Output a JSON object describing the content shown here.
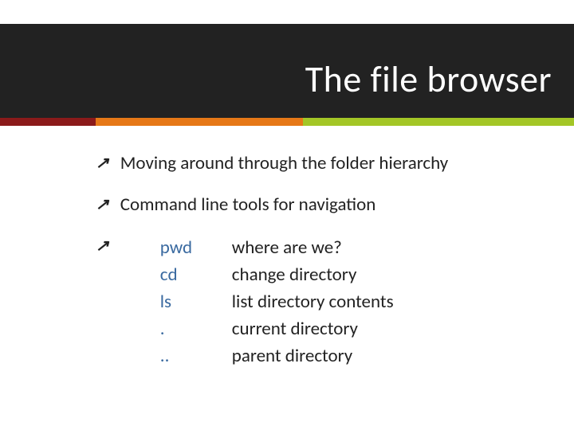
{
  "slide": {
    "title": "The file browser",
    "bullets": [
      "Moving around through the folder hierarchy",
      "Command line tools for navigation"
    ],
    "commands": [
      {
        "cmd": "pwd",
        "desc": "where are we?"
      },
      {
        "cmd": "cd",
        "desc": "change directory"
      },
      {
        "cmd": "ls",
        "desc": "list directory contents"
      },
      {
        "cmd": ".",
        "desc": "current directory"
      },
      {
        "cmd": "..",
        "desc": "parent directory"
      }
    ]
  }
}
